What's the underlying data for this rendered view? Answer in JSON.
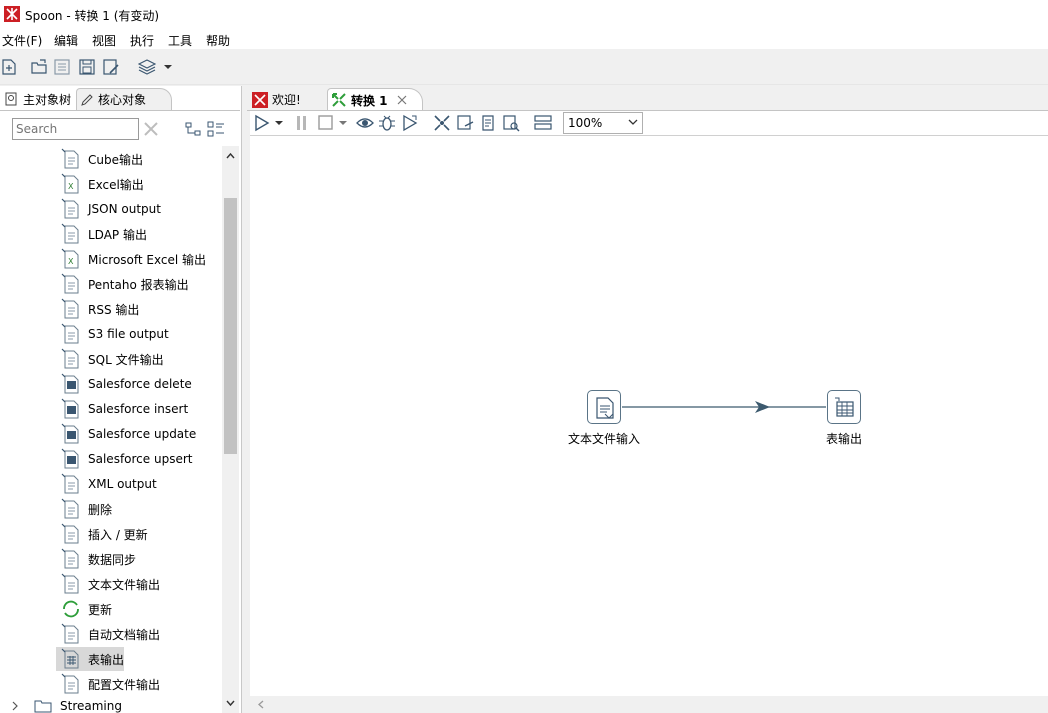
{
  "window": {
    "title": "Spoon - 转换 1 (有变动)"
  },
  "menu": [
    "文件(F)",
    "编辑",
    "视图",
    "执行",
    "工具",
    "帮助"
  ],
  "left_panel": {
    "tabs": [
      "主对象树",
      "核心对象"
    ],
    "search_placeholder": "Search",
    "items": [
      "Cube输出",
      "Excel输出",
      "JSON output",
      "LDAP 输出",
      "Microsoft Excel 输出",
      "Pentaho 报表输出",
      "RSS 输出",
      "S3 file output",
      "SQL 文件输出",
      "Salesforce delete",
      "Salesforce insert",
      "Salesforce update",
      "Salesforce upsert",
      "XML output",
      "删除",
      "插入 / 更新",
      "数据同步",
      "文本文件输出",
      "更新",
      "自动文档输出",
      "表输出",
      "配置文件输出"
    ],
    "selected_item": "表输出",
    "category": "Streaming"
  },
  "right_panel": {
    "tabs": [
      "欢迎!",
      "转换 1"
    ],
    "zoom": "100%",
    "steps": [
      {
        "label": "文本文件输入",
        "icon": "text-file-input-icon"
      },
      {
        "label": "表输出",
        "icon": "table-output-icon"
      }
    ]
  },
  "colors": {
    "hop": "#3c5a6e",
    "step_border": "#5a7487",
    "selected_bg": "#d8d8d8"
  }
}
